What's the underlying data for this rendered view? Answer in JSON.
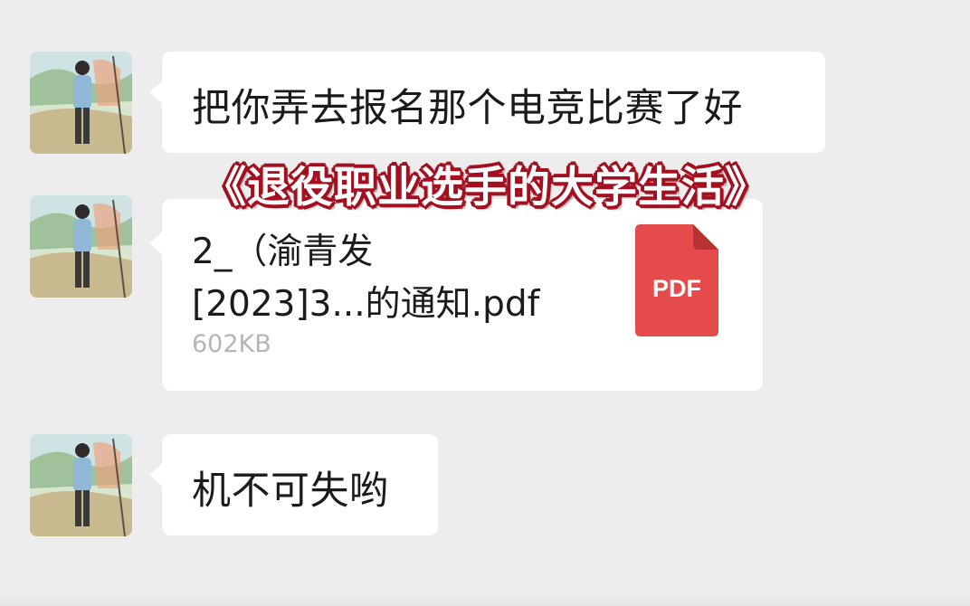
{
  "overlay": {
    "title": "《退役职业选手的大学生活》"
  },
  "messages": [
    {
      "type": "text",
      "text": "把你弄去报名那个电竞比赛了好"
    },
    {
      "type": "file",
      "file_name_line1": "2_（渝青发",
      "file_name_line2": "[2023]3...的通知.pdf",
      "file_size": "602KB",
      "file_icon": "pdf-file-icon",
      "file_icon_label": "PDF"
    },
    {
      "type": "text",
      "text": "机不可失哟"
    }
  ],
  "colors": {
    "background": "#ededed",
    "bubble": "#ffffff",
    "pdf_red": "#e54b4b",
    "title_outline": "#a4101f"
  }
}
